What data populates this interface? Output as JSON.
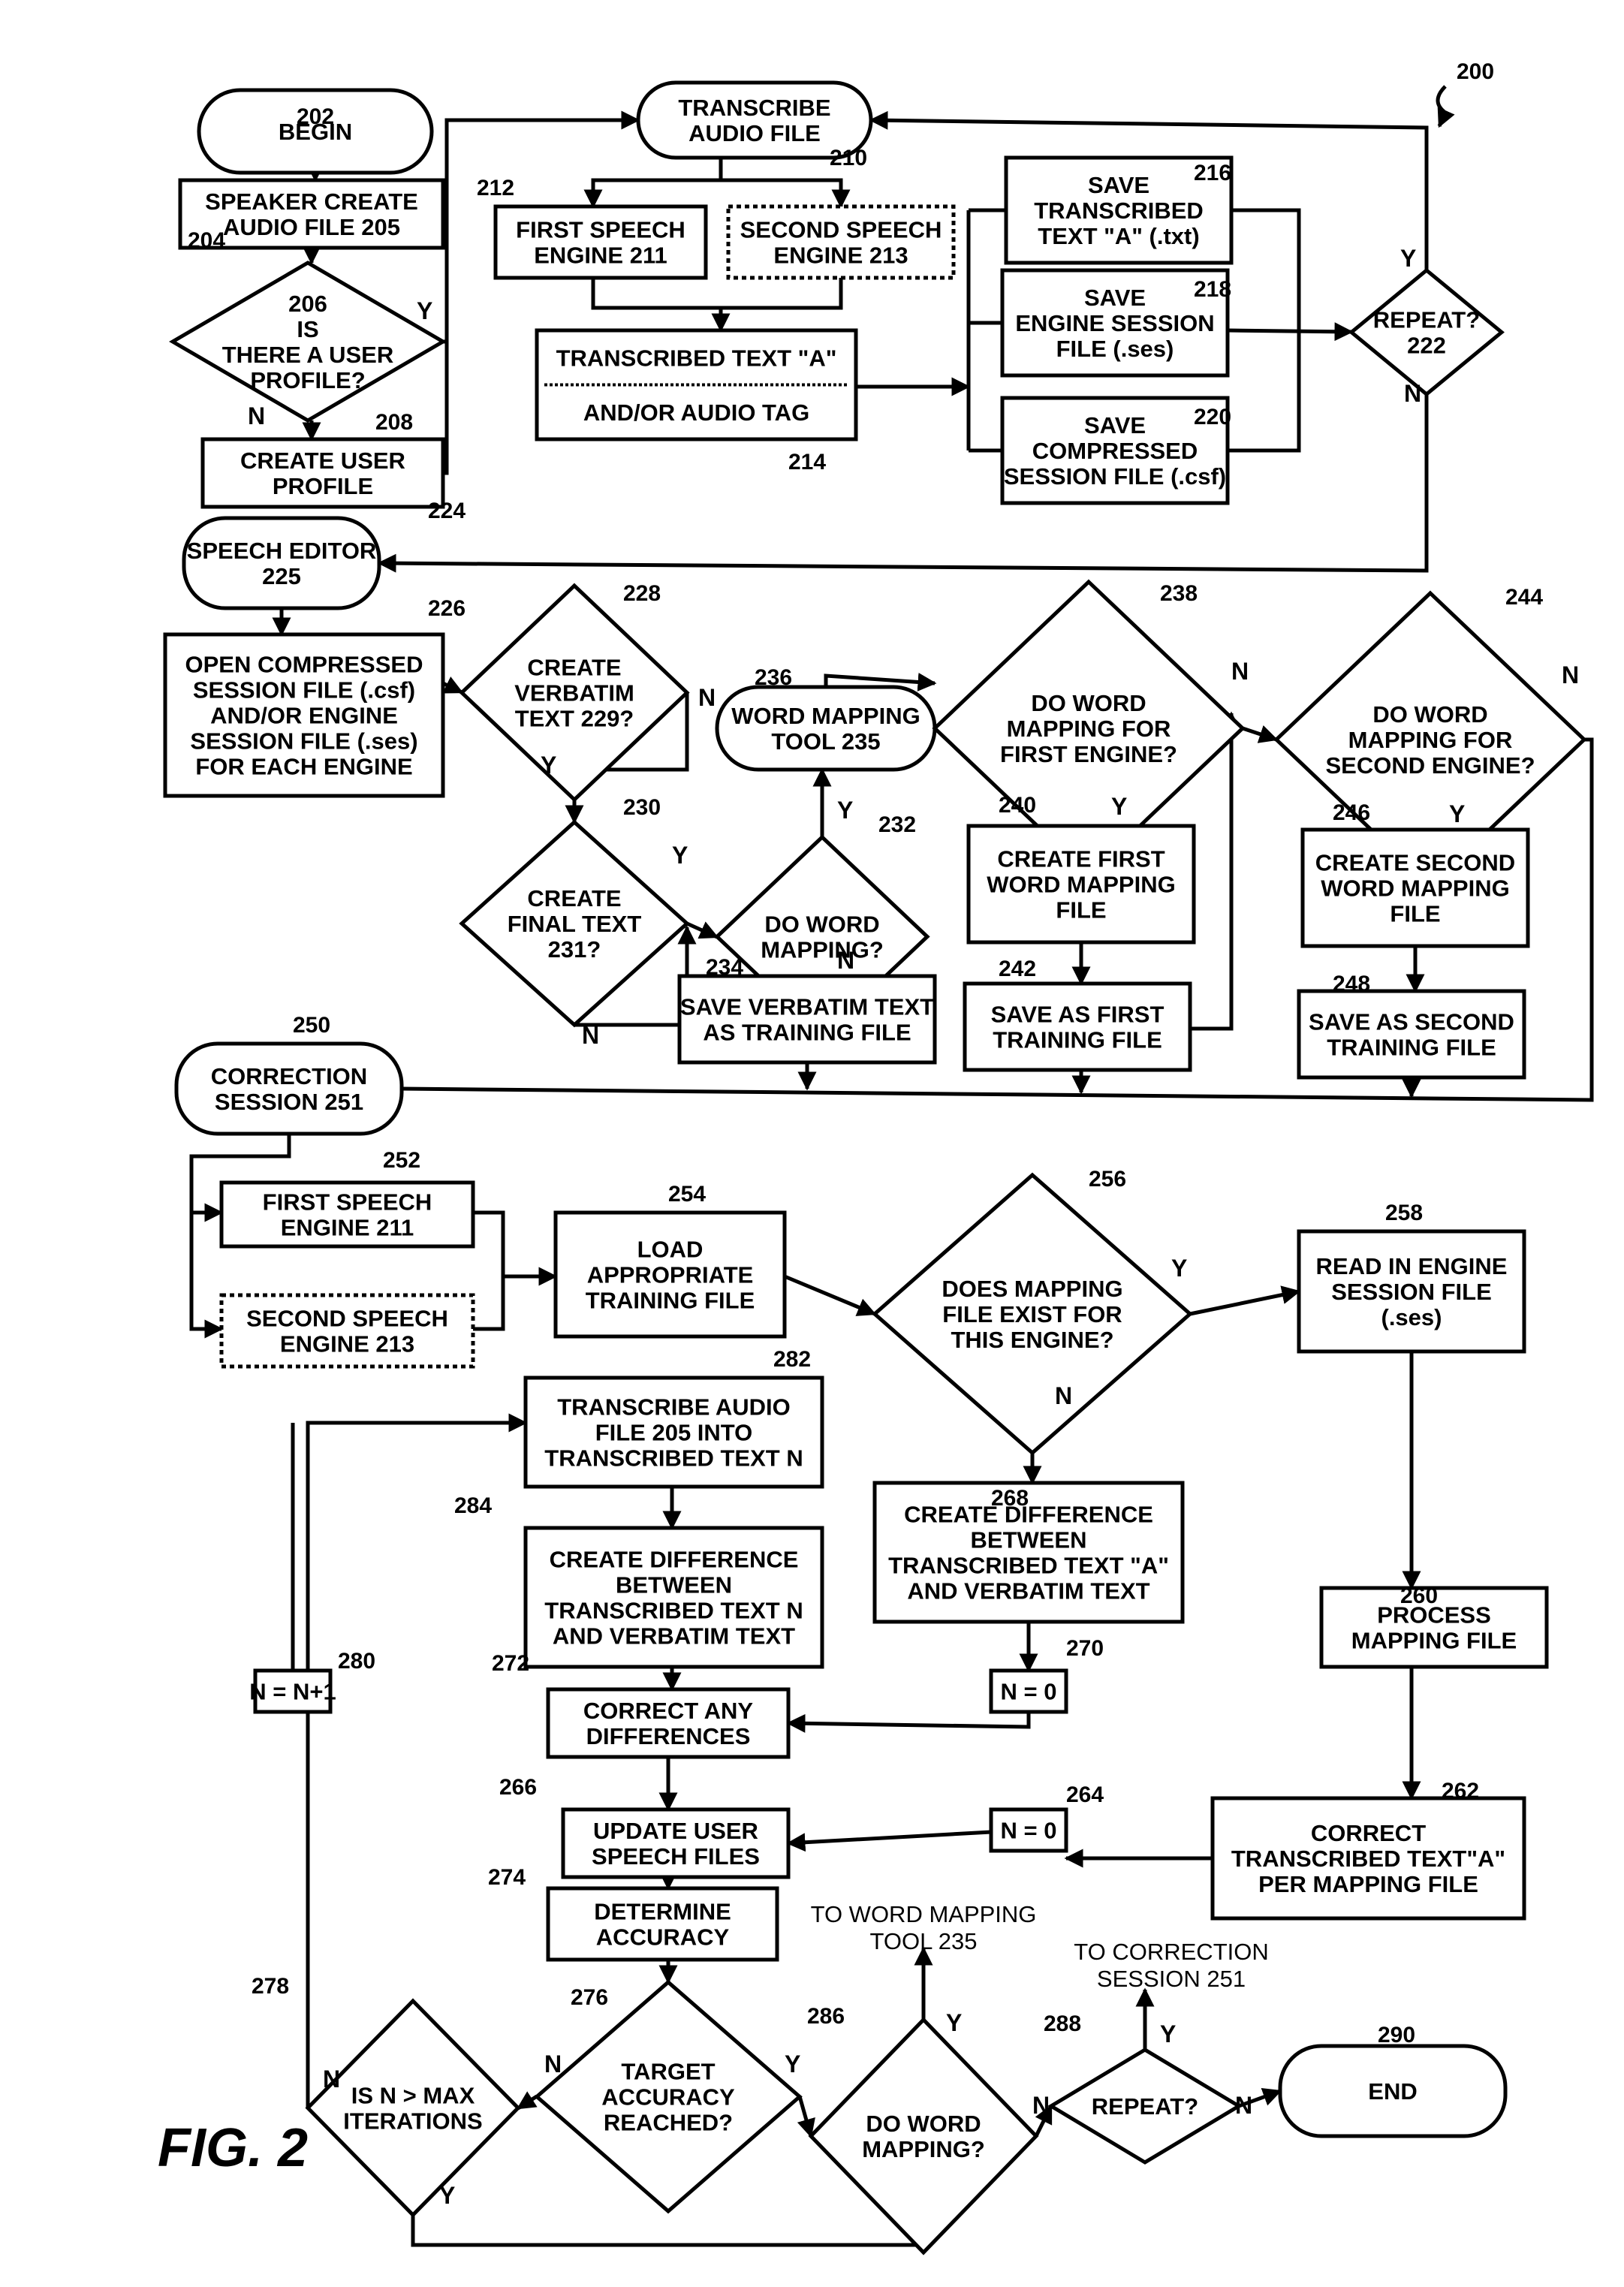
{
  "figure": {
    "label": "FIG. 2",
    "reference": "200"
  },
  "nodes": [
    {
      "id": "n202",
      "type": "terminal",
      "lines": [
        "BEGIN"
      ],
      "ref": "202"
    },
    {
      "id": "n204",
      "type": "process",
      "lines": [
        "SPEAKER CREATE",
        "AUDIO FILE 205"
      ],
      "ref": "204"
    },
    {
      "id": "n206",
      "type": "decision",
      "lines": [
        "206",
        "IS",
        "THERE A USER",
        "PROFILE?"
      ],
      "ref": ""
    },
    {
      "id": "n208",
      "type": "process",
      "lines": [
        "CREATE USER",
        "PROFILE"
      ],
      "ref": "208"
    },
    {
      "id": "n210",
      "type": "terminal",
      "lines": [
        "TRANSCRIBE",
        "AUDIO FILE"
      ],
      "ref": "210"
    },
    {
      "id": "n212",
      "type": "process",
      "lines": [
        "FIRST SPEECH",
        "ENGINE 211"
      ],
      "ref": "212"
    },
    {
      "id": "n213",
      "type": "process-dashed",
      "lines": [
        "SECOND SPEECH",
        "ENGINE 213"
      ],
      "ref": ""
    },
    {
      "id": "n214",
      "type": "process-split",
      "lines": [
        "TRANSCRIBED TEXT \"A\"",
        "AND/OR AUDIO TAG"
      ],
      "ref": "214"
    },
    {
      "id": "n216",
      "type": "process",
      "lines": [
        "SAVE",
        "TRANSCRIBED",
        "TEXT \"A\" (.txt)"
      ],
      "ref": "216"
    },
    {
      "id": "n218",
      "type": "process",
      "lines": [
        "SAVE",
        "ENGINE SESSION",
        "FILE (.ses)"
      ],
      "ref": "218"
    },
    {
      "id": "n220",
      "type": "process",
      "lines": [
        "SAVE",
        "COMPRESSED",
        "SESSION FILE (.csf)"
      ],
      "ref": "220"
    },
    {
      "id": "n222",
      "type": "decision",
      "lines": [
        "REPEAT?",
        "222"
      ],
      "ref": ""
    },
    {
      "id": "n224",
      "type": "terminal",
      "lines": [
        "SPEECH EDITOR",
        "225"
      ],
      "ref": "224"
    },
    {
      "id": "n226",
      "type": "process",
      "lines": [
        "OPEN COMPRESSED",
        "SESSION FILE (.csf)",
        "AND/OR ENGINE",
        "SESSION FILE (.ses)",
        "FOR EACH ENGINE"
      ],
      "ref": "226"
    },
    {
      "id": "n228",
      "type": "decision",
      "lines": [
        "CREATE",
        "VERBATIM",
        "TEXT 229?"
      ],
      "ref": "228"
    },
    {
      "id": "n230",
      "type": "decision",
      "lines": [
        "CREATE",
        "FINAL TEXT",
        "231?"
      ],
      "ref": "230"
    },
    {
      "id": "n232",
      "type": "decision",
      "lines": [
        "DO WORD",
        "MAPPING?"
      ],
      "ref": "232"
    },
    {
      "id": "n236",
      "type": "terminal",
      "lines": [
        "WORD MAPPING",
        "TOOL 235"
      ],
      "ref": "236"
    },
    {
      "id": "n234",
      "type": "process",
      "lines": [
        "SAVE VERBATIM TEXT",
        "AS TRAINING FILE"
      ],
      "ref": "234"
    },
    {
      "id": "n238",
      "type": "decision",
      "lines": [
        "DO WORD",
        "MAPPING FOR",
        "FIRST ENGINE?"
      ],
      "ref": "238"
    },
    {
      "id": "n240",
      "type": "process",
      "lines": [
        "CREATE FIRST",
        "WORD MAPPING",
        "FILE"
      ],
      "ref": "240"
    },
    {
      "id": "n242",
      "type": "process",
      "lines": [
        "SAVE AS FIRST",
        "TRAINING FILE"
      ],
      "ref": "242"
    },
    {
      "id": "n244",
      "type": "decision",
      "lines": [
        "DO WORD",
        "MAPPING FOR",
        "SECOND ENGINE?"
      ],
      "ref": "244"
    },
    {
      "id": "n246",
      "type": "process",
      "lines": [
        "CREATE SECOND",
        "WORD MAPPING",
        "FILE"
      ],
      "ref": "246"
    },
    {
      "id": "n248",
      "type": "process",
      "lines": [
        "SAVE AS SECOND",
        "TRAINING FILE"
      ],
      "ref": "248"
    },
    {
      "id": "n250",
      "type": "terminal",
      "lines": [
        "CORRECTION",
        "SESSION 251"
      ],
      "ref": "250"
    },
    {
      "id": "n252",
      "type": "process",
      "lines": [
        "FIRST SPEECH",
        "ENGINE 211"
      ],
      "ref": "252"
    },
    {
      "id": "n253",
      "type": "process-dashed",
      "lines": [
        "SECOND SPEECH",
        "ENGINE 213"
      ],
      "ref": ""
    },
    {
      "id": "n254",
      "type": "process",
      "lines": [
        "LOAD",
        "APPROPRIATE",
        "TRAINING FILE"
      ],
      "ref": "254"
    },
    {
      "id": "n256",
      "type": "decision",
      "lines": [
        "DOES MAPPING",
        "FILE EXIST FOR",
        "THIS ENGINE?"
      ],
      "ref": "256"
    },
    {
      "id": "n258",
      "type": "process",
      "lines": [
        "READ IN ENGINE",
        "SESSION FILE",
        "(.ses)"
      ],
      "ref": "258"
    },
    {
      "id": "n282",
      "type": "process",
      "lines": [
        "TRANSCRIBE AUDIO",
        "FILE 205 INTO",
        "TRANSCRIBED TEXT N"
      ],
      "ref": "282"
    },
    {
      "id": "n268",
      "type": "process",
      "lines": [
        "CREATE DIFFERENCE",
        "BETWEEN",
        "TRANSCRIBED TEXT \"A\"",
        "AND VERBATIM TEXT"
      ],
      "ref": "268"
    },
    {
      "id": "n284",
      "type": "process",
      "lines": [
        "CREATE DIFFERENCE",
        "BETWEEN",
        "TRANSCRIBED TEXT N",
        "AND VERBATIM TEXT"
      ],
      "ref": "284"
    },
    {
      "id": "n260",
      "type": "process",
      "lines": [
        "PROCESS",
        "MAPPING FILE"
      ],
      "ref": "260"
    },
    {
      "id": "n280",
      "type": "process",
      "lines": [
        "N = N+1"
      ],
      "ref": "280"
    },
    {
      "id": "n270",
      "type": "process",
      "lines": [
        "N = 0"
      ],
      "ref": "270"
    },
    {
      "id": "n272",
      "type": "process",
      "lines": [
        "CORRECT ANY",
        "DIFFERENCES"
      ],
      "ref": "272"
    },
    {
      "id": "n262",
      "type": "process",
      "lines": [
        "CORRECT",
        "TRANSCRIBED TEXT\"A\"",
        "PER MAPPING FILE"
      ],
      "ref": "262"
    },
    {
      "id": "n264",
      "type": "process",
      "lines": [
        "N = 0"
      ],
      "ref": "264"
    },
    {
      "id": "n266",
      "type": "process",
      "lines": [
        "UPDATE USER",
        "SPEECH FILES"
      ],
      "ref": "266"
    },
    {
      "id": "n274",
      "type": "process",
      "lines": [
        "DETERMINE",
        "ACCURACY"
      ],
      "ref": "274"
    },
    {
      "id": "n278",
      "type": "decision",
      "lines": [
        "IS N > MAX",
        "ITERATIONS"
      ],
      "ref": "278"
    },
    {
      "id": "n276",
      "type": "decision",
      "lines": [
        "TARGET",
        "ACCURACY",
        "REACHED?"
      ],
      "ref": "276"
    },
    {
      "id": "n286",
      "type": "decision",
      "lines": [
        "DO WORD",
        "MAPPING?"
      ],
      "ref": "286"
    },
    {
      "id": "n288",
      "type": "decision",
      "lines": [
        "REPEAT?"
      ],
      "ref": "288"
    },
    {
      "id": "n290",
      "type": "terminal",
      "lines": [
        "END"
      ],
      "ref": "290"
    }
  ],
  "off_page": [
    {
      "id": "to235",
      "lines": [
        "TO WORD MAPPING",
        "TOOL 235"
      ]
    },
    {
      "id": "to251",
      "lines": [
        "TO CORRECTION",
        "SESSION 251"
      ]
    }
  ],
  "branch_labels": {
    "n206": {
      "yes": "Y",
      "no": "N"
    },
    "n222": {
      "yes": "Y",
      "no": "N"
    },
    "n228": {
      "yes": "Y",
      "no": "N"
    },
    "n230": {
      "yes": "Y",
      "no": "N"
    },
    "n232": {
      "yes": "Y",
      "no": "N"
    },
    "n238": {
      "yes": "Y",
      "no": "N"
    },
    "n244": {
      "yes": "Y",
      "no": "N"
    },
    "n256": {
      "yes": "Y",
      "no": "N"
    },
    "n276": {
      "yes": "Y",
      "no": "N"
    },
    "n278": {
      "yes": "Y",
      "no": "N"
    },
    "n286": {
      "yes": "Y",
      "no": "N"
    },
    "n288": {
      "yes": "Y",
      "no": "N"
    }
  }
}
